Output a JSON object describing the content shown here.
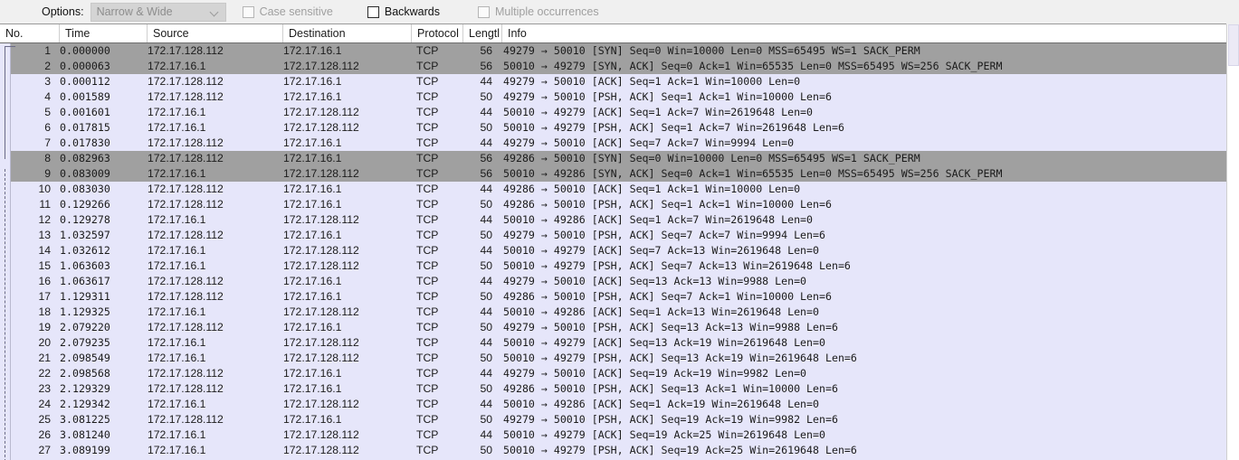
{
  "toolbar": {
    "options_label": "Options:",
    "search_mode": {
      "value": "Narrow & Wide",
      "enabled": false,
      "chevron_icon": "chevron-down-icon"
    },
    "checkboxes": [
      {
        "label": "Case sensitive",
        "checked": false,
        "enabled": false
      },
      {
        "label": "Backwards",
        "checked": false,
        "enabled": true
      },
      {
        "label": "Multiple occurrences",
        "checked": false,
        "enabled": false
      }
    ]
  },
  "columns": [
    {
      "key": "no",
      "label": "No."
    },
    {
      "key": "time",
      "label": "Time"
    },
    {
      "key": "src",
      "label": "Source"
    },
    {
      "key": "dst",
      "label": "Destination"
    },
    {
      "key": "proto",
      "label": "Protocol"
    },
    {
      "key": "len",
      "label": "Lengtl"
    },
    {
      "key": "info",
      "label": "Info"
    }
  ],
  "colors": {
    "row_default_bg": "#e6e6fa",
    "row_highlight_bg": "#a0a0a0",
    "toolbar_bg": "#f0f0f0",
    "text": "#1b1b1b",
    "disabled_text": "#a0a0a0"
  },
  "scrollbar": {
    "orientation": "vertical",
    "thumb_top_pct": 0,
    "thumb_height_pct": 9.5
  },
  "packets": [
    {
      "no": "1",
      "time": "0.000000",
      "src": "172.17.128.112",
      "dst": "172.17.16.1",
      "proto": "TCP",
      "len": "56",
      "info": "49279 → 50010 [SYN] Seq=0 Win=10000 Len=0 MSS=65495 WS=1 SACK_PERM",
      "hl": true
    },
    {
      "no": "2",
      "time": "0.000063",
      "src": "172.17.16.1",
      "dst": "172.17.128.112",
      "proto": "TCP",
      "len": "56",
      "info": "50010 → 49279 [SYN, ACK] Seq=0 Ack=1 Win=65535 Len=0 MSS=65495 WS=256 SACK_PERM",
      "hl": true
    },
    {
      "no": "3",
      "time": "0.000112",
      "src": "172.17.128.112",
      "dst": "172.17.16.1",
      "proto": "TCP",
      "len": "44",
      "info": "49279 → 50010 [ACK] Seq=1 Ack=1 Win=10000 Len=0",
      "hl": false
    },
    {
      "no": "4",
      "time": "0.001589",
      "src": "172.17.128.112",
      "dst": "172.17.16.1",
      "proto": "TCP",
      "len": "50",
      "info": "49279 → 50010 [PSH, ACK] Seq=1 Ack=1 Win=10000 Len=6",
      "hl": false
    },
    {
      "no": "5",
      "time": "0.001601",
      "src": "172.17.16.1",
      "dst": "172.17.128.112",
      "proto": "TCP",
      "len": "44",
      "info": "50010 → 49279 [ACK] Seq=1 Ack=7 Win=2619648 Len=0",
      "hl": false
    },
    {
      "no": "6",
      "time": "0.017815",
      "src": "172.17.16.1",
      "dst": "172.17.128.112",
      "proto": "TCP",
      "len": "50",
      "info": "50010 → 49279 [PSH, ACK] Seq=1 Ack=7 Win=2619648 Len=6",
      "hl": false
    },
    {
      "no": "7",
      "time": "0.017830",
      "src": "172.17.128.112",
      "dst": "172.17.16.1",
      "proto": "TCP",
      "len": "44",
      "info": "49279 → 50010 [ACK] Seq=7 Ack=7 Win=9994 Len=0",
      "hl": false
    },
    {
      "no": "8",
      "time": "0.082963",
      "src": "172.17.128.112",
      "dst": "172.17.16.1",
      "proto": "TCP",
      "len": "56",
      "info": "49286 → 50010 [SYN] Seq=0 Win=10000 Len=0 MSS=65495 WS=1 SACK_PERM",
      "hl": true
    },
    {
      "no": "9",
      "time": "0.083009",
      "src": "172.17.16.1",
      "dst": "172.17.128.112",
      "proto": "TCP",
      "len": "56",
      "info": "50010 → 49286 [SYN, ACK] Seq=0 Ack=1 Win=65535 Len=0 MSS=65495 WS=256 SACK_PERM",
      "hl": true
    },
    {
      "no": "10",
      "time": "0.083030",
      "src": "172.17.128.112",
      "dst": "172.17.16.1",
      "proto": "TCP",
      "len": "44",
      "info": "49286 → 50010 [ACK] Seq=1 Ack=1 Win=10000 Len=0",
      "hl": false
    },
    {
      "no": "11",
      "time": "0.129266",
      "src": "172.17.128.112",
      "dst": "172.17.16.1",
      "proto": "TCP",
      "len": "50",
      "info": "49286 → 50010 [PSH, ACK] Seq=1 Ack=1 Win=10000 Len=6",
      "hl": false
    },
    {
      "no": "12",
      "time": "0.129278",
      "src": "172.17.16.1",
      "dst": "172.17.128.112",
      "proto": "TCP",
      "len": "44",
      "info": "50010 → 49286 [ACK] Seq=1 Ack=7 Win=2619648 Len=0",
      "hl": false
    },
    {
      "no": "13",
      "time": "1.032597",
      "src": "172.17.128.112",
      "dst": "172.17.16.1",
      "proto": "TCP",
      "len": "50",
      "info": "49279 → 50010 [PSH, ACK] Seq=7 Ack=7 Win=9994 Len=6",
      "hl": false
    },
    {
      "no": "14",
      "time": "1.032612",
      "src": "172.17.16.1",
      "dst": "172.17.128.112",
      "proto": "TCP",
      "len": "44",
      "info": "50010 → 49279 [ACK] Seq=7 Ack=13 Win=2619648 Len=0",
      "hl": false
    },
    {
      "no": "15",
      "time": "1.063603",
      "src": "172.17.16.1",
      "dst": "172.17.128.112",
      "proto": "TCP",
      "len": "50",
      "info": "50010 → 49279 [PSH, ACK] Seq=7 Ack=13 Win=2619648 Len=6",
      "hl": false
    },
    {
      "no": "16",
      "time": "1.063617",
      "src": "172.17.128.112",
      "dst": "172.17.16.1",
      "proto": "TCP",
      "len": "44",
      "info": "49279 → 50010 [ACK] Seq=13 Ack=13 Win=9988 Len=0",
      "hl": false
    },
    {
      "no": "17",
      "time": "1.129311",
      "src": "172.17.128.112",
      "dst": "172.17.16.1",
      "proto": "TCP",
      "len": "50",
      "info": "49286 → 50010 [PSH, ACK] Seq=7 Ack=1 Win=10000 Len=6",
      "hl": false
    },
    {
      "no": "18",
      "time": "1.129325",
      "src": "172.17.16.1",
      "dst": "172.17.128.112",
      "proto": "TCP",
      "len": "44",
      "info": "50010 → 49286 [ACK] Seq=1 Ack=13 Win=2619648 Len=0",
      "hl": false
    },
    {
      "no": "19",
      "time": "2.079220",
      "src": "172.17.128.112",
      "dst": "172.17.16.1",
      "proto": "TCP",
      "len": "50",
      "info": "49279 → 50010 [PSH, ACK] Seq=13 Ack=13 Win=9988 Len=6",
      "hl": false
    },
    {
      "no": "20",
      "time": "2.079235",
      "src": "172.17.16.1",
      "dst": "172.17.128.112",
      "proto": "TCP",
      "len": "44",
      "info": "50010 → 49279 [ACK] Seq=13 Ack=19 Win=2619648 Len=0",
      "hl": false
    },
    {
      "no": "21",
      "time": "2.098549",
      "src": "172.17.16.1",
      "dst": "172.17.128.112",
      "proto": "TCP",
      "len": "50",
      "info": "50010 → 49279 [PSH, ACK] Seq=13 Ack=19 Win=2619648 Len=6",
      "hl": false
    },
    {
      "no": "22",
      "time": "2.098568",
      "src": "172.17.128.112",
      "dst": "172.17.16.1",
      "proto": "TCP",
      "len": "44",
      "info": "49279 → 50010 [ACK] Seq=19 Ack=19 Win=9982 Len=0",
      "hl": false
    },
    {
      "no": "23",
      "time": "2.129329",
      "src": "172.17.128.112",
      "dst": "172.17.16.1",
      "proto": "TCP",
      "len": "50",
      "info": "49286 → 50010 [PSH, ACK] Seq=13 Ack=1 Win=10000 Len=6",
      "hl": false
    },
    {
      "no": "24",
      "time": "2.129342",
      "src": "172.17.16.1",
      "dst": "172.17.128.112",
      "proto": "TCP",
      "len": "44",
      "info": "50010 → 49286 [ACK] Seq=1 Ack=19 Win=2619648 Len=0",
      "hl": false
    },
    {
      "no": "25",
      "time": "3.081225",
      "src": "172.17.128.112",
      "dst": "172.17.16.1",
      "proto": "TCP",
      "len": "50",
      "info": "49279 → 50010 [PSH, ACK] Seq=19 Ack=19 Win=9982 Len=6",
      "hl": false
    },
    {
      "no": "26",
      "time": "3.081240",
      "src": "172.17.16.1",
      "dst": "172.17.128.112",
      "proto": "TCP",
      "len": "44",
      "info": "50010 → 49279 [ACK] Seq=19 Ack=25 Win=2619648 Len=0",
      "hl": false
    },
    {
      "no": "27",
      "time": "3.089199",
      "src": "172.17.16.1",
      "dst": "172.17.128.112",
      "proto": "TCP",
      "len": "50",
      "info": "50010 → 49279 [PSH, ACK] Seq=19 Ack=25 Win=2619648 Len=6",
      "hl": false
    }
  ]
}
